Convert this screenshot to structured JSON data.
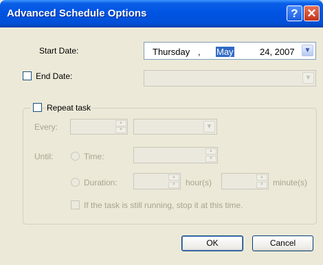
{
  "window": {
    "title": "Advanced Schedule Options",
    "help_glyph": "?",
    "close_glyph": "✕"
  },
  "start_date": {
    "label": "Start Date:",
    "weekday": "Thursday",
    "separator": ",",
    "month": "May",
    "day_year": "24, 2007"
  },
  "end_date": {
    "label": "End Date:",
    "checked": false,
    "value": ""
  },
  "repeat": {
    "label": "Repeat task",
    "checked": false,
    "every_label": "Every:",
    "every_value": "",
    "every_unit": "",
    "until_label": "Until:",
    "time_label": "Time:",
    "duration_label": "Duration:",
    "hours_suffix": "hour(s)",
    "minutes_suffix": "minute(s)",
    "stop_label": "If the task is still running, stop it at this time."
  },
  "buttons": {
    "ok": "OK",
    "cancel": "Cancel"
  },
  "icons": {
    "dropdown": "chevron-down-icon",
    "spin_up": "spin-up-icon",
    "spin_down": "spin-down-icon"
  }
}
